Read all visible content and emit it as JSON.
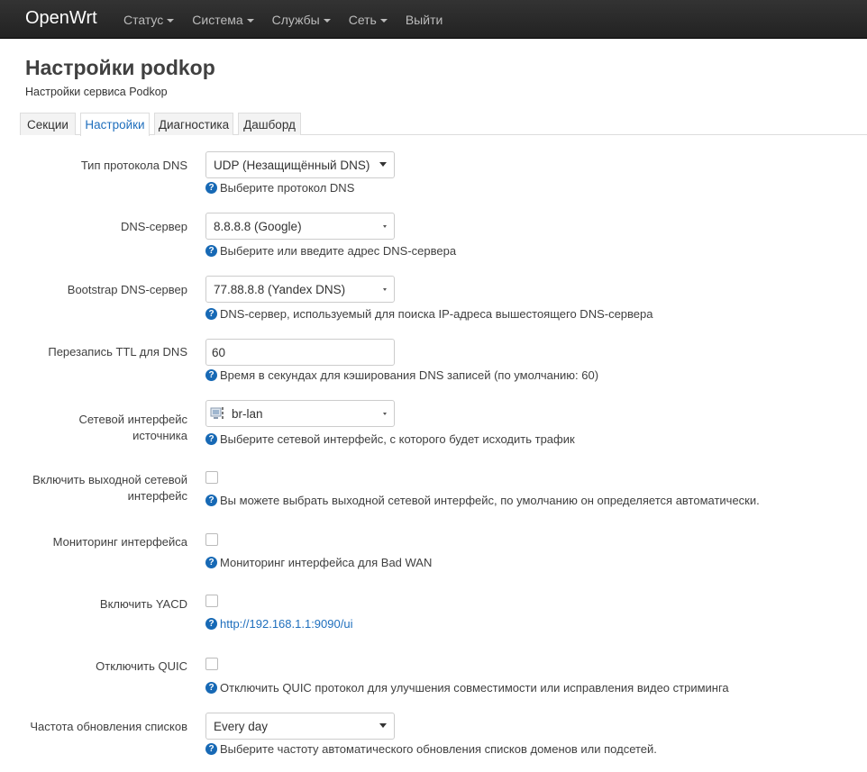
{
  "navbar": {
    "brand": "OpenWrt",
    "menu": [
      {
        "label": "Статус"
      },
      {
        "label": "Система"
      },
      {
        "label": "Службы"
      },
      {
        "label": "Сеть"
      },
      {
        "label": "Выйти"
      }
    ]
  },
  "page": {
    "title": "Настройки podkop",
    "description": "Настройки сервиса Podkop"
  },
  "tabs": [
    "Секции",
    "Настройки",
    "Диагностика",
    "Дашборд"
  ],
  "active_tab": "Настройки",
  "fields": {
    "dns_protocol": {
      "label": "Тип протокола DNS",
      "value": "UDP (Незащищённый DNS)",
      "help": "Выберите протокол DNS"
    },
    "dns_server": {
      "label": "DNS-сервер",
      "value": "8.8.8.8 (Google)",
      "help": "Выберите или введите адрес DNS-сервера"
    },
    "bootstrap_dns": {
      "label": "Bootstrap DNS-сервер",
      "value": "77.88.8.8 (Yandex DNS)",
      "help": "DNS-сервер, используемый для поиска IP-адреса вышестоящего DNS-сервера"
    },
    "ttl": {
      "label": "Перезапись TTL для DNS",
      "value": "60",
      "help": "Время в секундах для кэширования DNS записей (по умолчанию: 60)"
    },
    "source_iface": {
      "label_line1": "Сетевой интерфейс",
      "label_line2": "источника",
      "value": "br-lan",
      "help": "Выберите сетевой интерфейс, с которого будет исходить трафик"
    },
    "out_iface": {
      "label_line1": "Включить выходной сетевой",
      "label_line2": "интерфейс",
      "checked": false,
      "help": "Вы можете выбрать выходной сетевой интерфейс, по умолчанию он определяется автоматически."
    },
    "monitoring": {
      "label": "Мониторинг интерфейса",
      "checked": false,
      "help": "Мониторинг интерфейса для Bad WAN"
    },
    "yacd": {
      "label": "Включить YACD",
      "checked": false,
      "help_link": "http://192.168.1.1:9090/ui"
    },
    "quic": {
      "label": "Отключить QUIC",
      "checked": false,
      "help": "Отключить QUIC протокол для улучшения совместимости или исправления видео стриминга"
    },
    "update_freq": {
      "label": "Частота обновления списков",
      "value": "Every day",
      "help": "Выберите частоту автоматического обновления списков доменов или подсетей."
    }
  },
  "colors": {
    "accent": "#1f6fbd",
    "help_icon": "#1769b5",
    "navbar": "#222222"
  }
}
